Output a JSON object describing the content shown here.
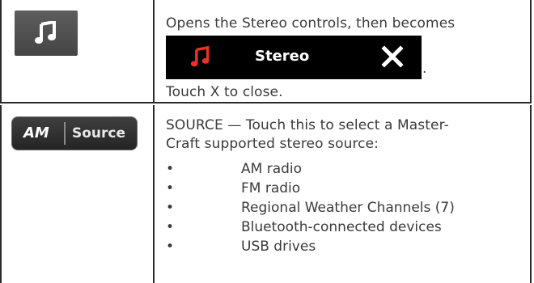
{
  "row1": {
    "icon": "music-note-icon",
    "description_line1": "Opens the Stereo controls, then becomes",
    "stereo_bar": {
      "icon": "music-note-icon",
      "icon_color": "#e8322a",
      "label": "Stereo",
      "close_icon": "close-x-icon"
    },
    "period": ".",
    "description_line2": "Touch X to close."
  },
  "row2": {
    "button": {
      "am_label": "AM",
      "source_label": "Source"
    },
    "description_line1": "SOURCE — Touch this to select a Master-",
    "description_line2": "Craft supported stereo source:",
    "bullet_char": "•",
    "sources": [
      "AM radio",
      "FM radio",
      "Regional Weather Channels (7)",
      "Bluetooth-connected devices",
      "USB drives"
    ]
  }
}
